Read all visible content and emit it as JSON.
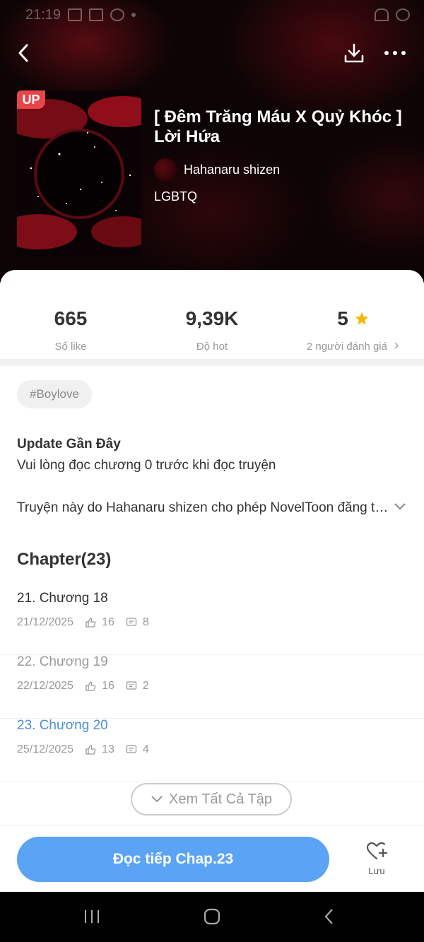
{
  "status_bar": {
    "time": "21:19"
  },
  "book": {
    "up_badge": "UP",
    "title": "[ Đêm Trăng Máu X Quỷ Khóc ] Lời Hứa",
    "author": "Hahanaru shizen",
    "genre": "LGBTQ"
  },
  "stats": {
    "likes_value": "665",
    "likes_label": "Số like",
    "hot_value": "9,39K",
    "hot_label": "Độ hot",
    "rating_value": "5",
    "rating_label": "2 người đánh giá"
  },
  "tag": "#Boylove",
  "update": {
    "title": "Update Gần Đây",
    "text": "Vui lòng đọc chương 0 trước khi đọc truyện"
  },
  "description": "Truyện này do Hahanaru shizen cho phép NovelToon đăng tải độc quyền",
  "chapters_heading": "Chapter(23)",
  "chapters": [
    {
      "title": "21. Chương 18",
      "date": "21/12/2025",
      "likes": "16",
      "comments": "8"
    },
    {
      "title": "22. Chương 19",
      "date": "22/12/2025",
      "likes": "16",
      "comments": "2"
    },
    {
      "title": "23. Chương 20",
      "date": "25/12/2025",
      "likes": "13",
      "comments": "4"
    }
  ],
  "view_all_label": "Xem Tất Cả Tập",
  "read_button_label": "Đọc tiếp Chap.23",
  "save_label": "Lưu",
  "colors": {
    "accent": "#5ba3f5",
    "active_chapter": "#4a90d9",
    "up_badge": "#e8454b",
    "star": "#f5b800"
  }
}
